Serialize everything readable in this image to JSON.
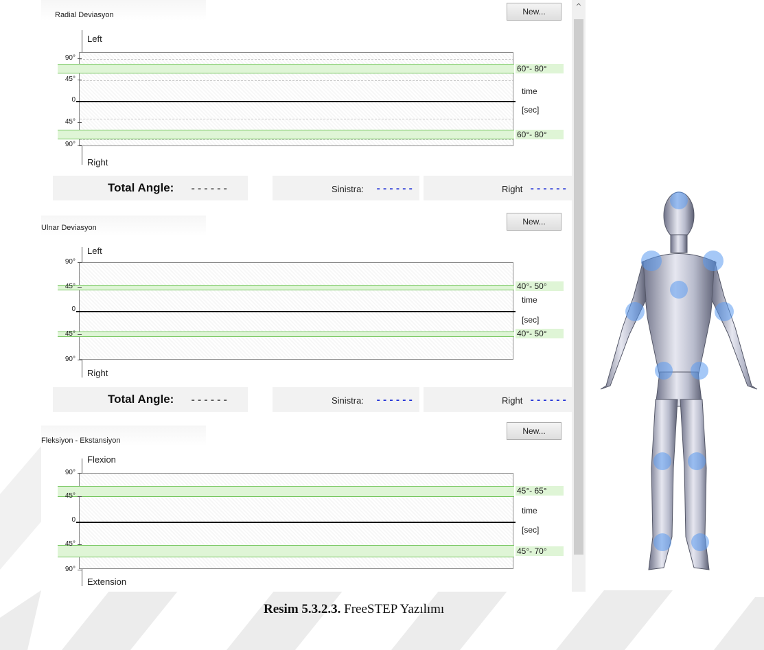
{
  "sections": [
    {
      "title": "Radial Deviasyon",
      "new_label": "New...",
      "axis_top": "Left",
      "axis_bottom": "Right",
      "y_ticks": [
        "90°",
        "45°",
        "0",
        "45°",
        "90°"
      ],
      "upper_range": "60°- 80°",
      "lower_range": "60°- 80°",
      "time_label": "time",
      "time_unit": "[sec]",
      "total_label": "Total Angle:",
      "total_value": "------",
      "left_label": "Sinistra:",
      "left_value": "------",
      "right_label": "Right",
      "right_value": "------"
    },
    {
      "title": "Ulnar Deviasyon",
      "new_label": "New...",
      "axis_top": "Left",
      "axis_bottom": "Right",
      "y_ticks": [
        "90°",
        "45°",
        "0",
        "45°",
        "90°"
      ],
      "upper_range": "40°- 50°",
      "lower_range": "40°- 50°",
      "time_label": "time",
      "time_unit": "[sec]",
      "total_label": "Total Angle:",
      "total_value": "------",
      "left_label": "Sinistra:",
      "left_value": "------",
      "right_label": "Right",
      "right_value": "------"
    },
    {
      "title": "Fleksiyon - Ekstansiyon",
      "new_label": "New...",
      "axis_top": "Flexion",
      "axis_bottom": "Extension",
      "y_ticks": [
        "90°",
        "45°",
        "0",
        "45°",
        "90°"
      ],
      "upper_range": "45°- 65°",
      "lower_range": "45°- 70°",
      "time_label": "time",
      "time_unit": "[sec]"
    }
  ],
  "caption": {
    "number": "Resim 5.3.2.3.",
    "text": " FreeSTEP Yazılımı"
  },
  "colors": {
    "band_fill": "#dff5d6",
    "band_border": "#73c55c",
    "value_blue": "#1f2fd6",
    "joint_marker": "#5b9bf0"
  },
  "icons": {
    "scroll_up": "chevron-up-icon",
    "body_model": "human-body-model-icon"
  }
}
